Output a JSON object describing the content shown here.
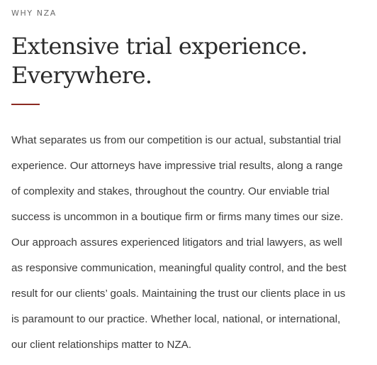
{
  "section": {
    "eyebrow": "WHY NZA",
    "headline_lines": [
      "Extensive trial experience.",
      "Everywhere."
    ],
    "accent_color": "#8b2a22",
    "body_lines": [
      "What separates us from our competition is our actual, substantial trial",
      "experience. Our attorneys have impressive trial results, along a range",
      "of complexity and stakes, throughout the country. Our enviable trial",
      "success is uncommon in a boutique firm or firms many times our size.",
      "Our approach assures experienced litigators and trial lawyers, as well",
      "as responsive communication, meaningful quality control, and the best",
      "result for our clients’ goals. Maintaining the trust our clients place in us",
      "is paramount to our practice. Whether local, national, or international,",
      "our client relationships matter to NZA."
    ]
  }
}
